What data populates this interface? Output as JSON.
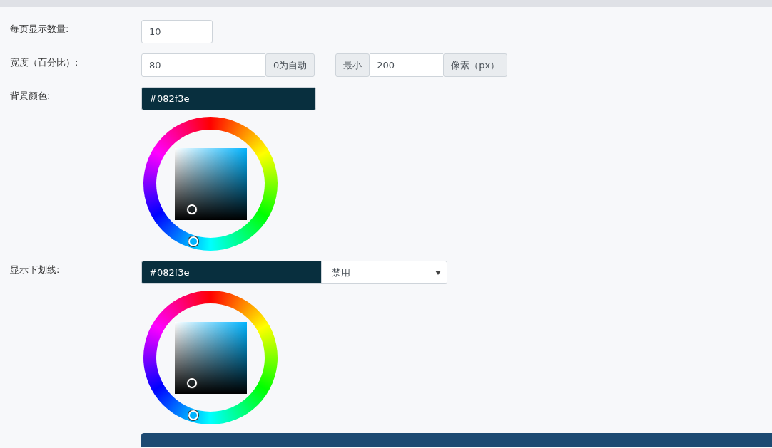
{
  "rows": [
    {
      "kind": "number",
      "label": "每页显示数量:",
      "value": "10"
    },
    {
      "kind": "width",
      "label": "宽度（百分比）:",
      "value": "80",
      "suffix": "0为自动",
      "min_label": "最小",
      "min_value": "200",
      "min_suffix": "像素（px）"
    },
    {
      "kind": "color",
      "label": "背景颜色:",
      "value": "#082f3e"
    },
    {
      "kind": "color_select",
      "label": "显示下划线:",
      "value": "#082f3e",
      "select": "禁用"
    }
  ]
}
